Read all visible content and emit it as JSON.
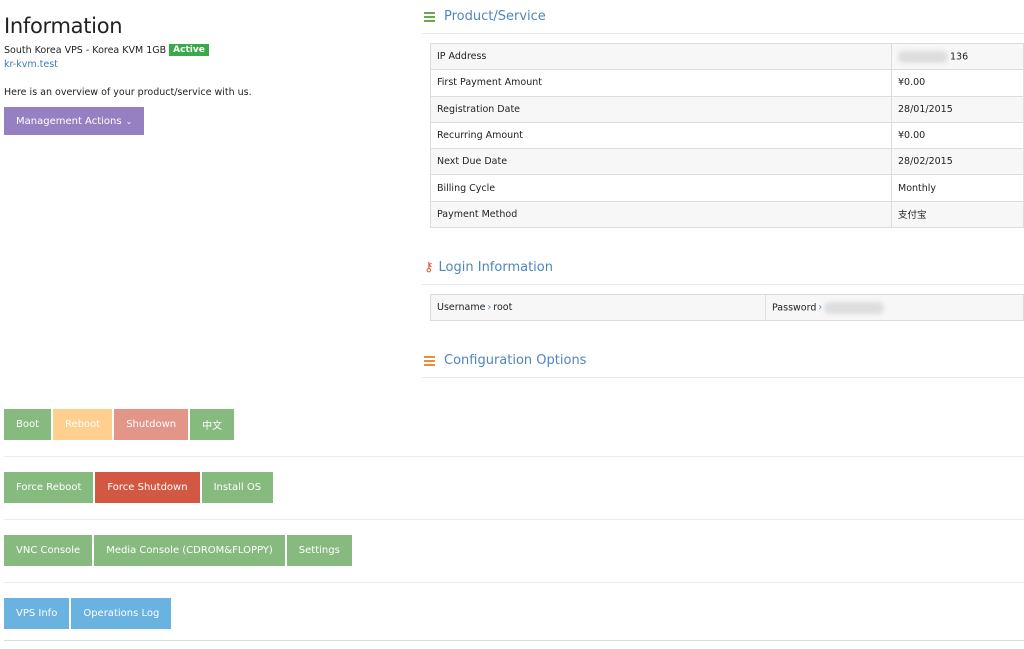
{
  "info": {
    "title": "Information",
    "product_name": "South Korea VPS - Korea KVM 1GB",
    "status_badge": "Active",
    "domain": "kr-kvm.test",
    "overview": "Here is an overview of your product/service with us.",
    "management_actions_label": "Management Actions"
  },
  "product_service": {
    "heading": "Product/Service",
    "rows": [
      {
        "label": "IP Address",
        "value": "136"
      },
      {
        "label": "First Payment Amount",
        "value": "¥0.00"
      },
      {
        "label": "Registration Date",
        "value": "28/01/2015"
      },
      {
        "label": "Recurring Amount",
        "value": "¥0.00"
      },
      {
        "label": "Next Due Date",
        "value": "28/02/2015"
      },
      {
        "label": "Billing Cycle",
        "value": "Monthly"
      },
      {
        "label": "Payment Method",
        "value": "支付宝"
      }
    ]
  },
  "login": {
    "heading": "Login Information",
    "username_label": "Username",
    "username": "root",
    "password_label": "Password"
  },
  "config": {
    "heading": "Configuration Options"
  },
  "actions": {
    "row1": [
      "Boot",
      "Reboot",
      "Shutdown",
      "中文"
    ],
    "row2": [
      "Force Reboot",
      "Force Shutdown",
      "Install OS"
    ],
    "row3": [
      "VNC Console",
      "Media Console (CDROM&FLOPPY)",
      "Settings"
    ],
    "row4": [
      "VPS Info",
      "Operations Log"
    ]
  },
  "colors": {
    "green": "#86ba7f",
    "orange": "#fecf8f",
    "salmon": "#e39587",
    "red": "#d35844",
    "blue": "#6ab2e0",
    "purple": "#9580c1",
    "active": "#3aa94a",
    "heading": "#4f86bc"
  }
}
